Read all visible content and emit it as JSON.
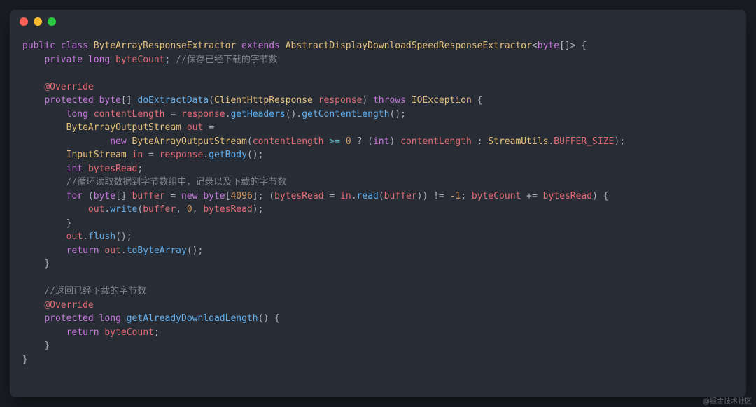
{
  "window": {
    "buttons": [
      "close",
      "minimize",
      "zoom"
    ]
  },
  "code": {
    "l1": {
      "kw1": "public",
      "kw2": "class",
      "cls": "ByteArrayResponseExtractor",
      "kw3": "extends",
      "sup": "AbstractDisplayDownloadSpeedResponseExtractor",
      "gen_open": "<",
      "gen_kw": "byte",
      "gen_arr": "[]",
      "gen_close": ">",
      "brace": " {"
    },
    "l2": {
      "kw1": "private",
      "kw2": "long",
      "var": "byteCount",
      "semi": ";",
      "cmt": "//保存已经下载的字节数"
    },
    "l3": {
      "anno": "@Override"
    },
    "l4": {
      "kw1": "protected",
      "ret": "byte",
      "arr": "[]",
      "fn": "doExtractData",
      "p_type": "ClientHttpResponse",
      "p_name": "response",
      "kw2": "throws",
      "ex": "IOException",
      "brace": " {"
    },
    "l5": {
      "kw": "long",
      "var": "contentLength",
      "eq": " = ",
      "obj": "response",
      "dot1": ".",
      "m1": "getHeaders",
      "p1": "()",
      "dot2": ".",
      "m2": "getContentLength",
      "p2": "();"
    },
    "l6": {
      "type": "ByteArrayOutputStream",
      "var": "out",
      "rest": " ="
    },
    "l7": {
      "kw": "new",
      "type": "ByteArrayOutputStream",
      "open": "(",
      "v1": "contentLength",
      "op1": " >= ",
      "zero": "0",
      "q": " ? (",
      "cast": "int",
      "paren": ") ",
      "v2": "contentLength",
      "colon": " : ",
      "cls": "StreamUtils",
      "dot": ".",
      "cons": "BUFFER_SIZE",
      "close": ");"
    },
    "l8": {
      "type": "InputStream",
      "var": "in",
      "eq": " = ",
      "obj": "response",
      "dot": ".",
      "m": "getBody",
      "p": "();"
    },
    "l9": {
      "kw": "int",
      "var": "bytesRead",
      "semi": ";"
    },
    "l10": {
      "cmt": "//循环读取数据到字节数组中，记录以及下载的字节数"
    },
    "l11": {
      "kw1": "for",
      "open": " (",
      "kw2": "byte",
      "arr": "[] ",
      "var1": "buffer",
      "eq1": " = ",
      "kw3": "new",
      "kw4": " byte",
      "br_open": "[",
      "num": "4096",
      "br_close": "]; (",
      "var2": "bytesRead",
      "eq2": " = ",
      "obj": "in",
      "dot": ".",
      "m": "read",
      "p_open": "(",
      "arg": "buffer",
      "p_close": ")) != ",
      "neg": "-1",
      "semi": "; ",
      "var3": "byteCount",
      "pluseq": " += ",
      "var4": "bytesRead",
      "close": ") {"
    },
    "l12": {
      "obj": "out",
      "dot": ".",
      "m": "write",
      "open": "(",
      "a1": "buffer",
      "c1": ", ",
      "a2": "0",
      "c2": ", ",
      "a3": "bytesRead",
      "close": ");"
    },
    "l13": {
      "brace": "}"
    },
    "l14": {
      "obj": "out",
      "dot": ".",
      "m": "flush",
      "p": "();"
    },
    "l15": {
      "kw": "return",
      "sp": " ",
      "obj": "out",
      "dot": ".",
      "m": "toByteArray",
      "p": "();"
    },
    "l16": {
      "brace": "}"
    },
    "l17": {
      "cmt": "//返回已经下载的字节数"
    },
    "l18": {
      "anno": "@Override"
    },
    "l19": {
      "kw1": "protected",
      "kw2": "long",
      "fn": "getAlreadyDownloadLength",
      "p": "()",
      "brace": " {"
    },
    "l20": {
      "kw": "return",
      "sp": " ",
      "var": "byteCount",
      "semi": ";"
    },
    "l21": {
      "brace": "}"
    },
    "l22": {
      "brace": "}"
    }
  },
  "watermark": "@掘金技术社区"
}
